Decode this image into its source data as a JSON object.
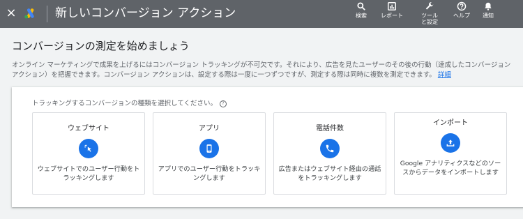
{
  "header": {
    "close_glyph": "×",
    "title": "新しいコンバージョン アクション",
    "logo_colors": [
      "#fbbc04",
      "#4285f4",
      "#34a853"
    ],
    "background": "#5f6368",
    "tools": [
      {
        "label": "検索",
        "icon": "search-icon"
      },
      {
        "label": "レポート",
        "icon": "reports-icon"
      },
      {
        "label": "ツールと設定",
        "icon": "wrench-icon"
      },
      {
        "label": "ヘルプ",
        "icon": "help-icon"
      },
      {
        "label": "通知",
        "icon": "bell-icon"
      }
    ]
  },
  "main": {
    "heading": "コンバージョンの測定を始めましょう",
    "description_line1": "オンライン マーケティングで成果を上げるにはコンバージョン トラッキングが不可欠です。それにより、広告を見たユーザーのその後の行動（達成したコンバージョン",
    "description_line2": "アクション）を把握できます。コンバージョン アクションは、設定する際は一度に一つずつですが、測定する際は同時に複数を測定できます。",
    "details_link": "詳細"
  },
  "panel": {
    "prompt": "トラッキングするコンバージョンの種類を選択してください。",
    "accent_color": "#1a73e8",
    "cards": [
      {
        "title": "ウェブサイト",
        "icon": "cursor-click-icon",
        "desc": "ウェブサイトでのユーザー行動をトラッキングします"
      },
      {
        "title": "アプリ",
        "icon": "smartphone-icon",
        "desc": "アプリでのユーザー行動をトラッキングします"
      },
      {
        "title": "電話件数",
        "icon": "phone-icon",
        "desc": "広告またはウェブサイト経由の通話をトラッキングします"
      },
      {
        "title": "インポート",
        "icon": "upload-icon",
        "desc": "Google アナリティクスなどのソースからデータをインポートします"
      }
    ]
  }
}
